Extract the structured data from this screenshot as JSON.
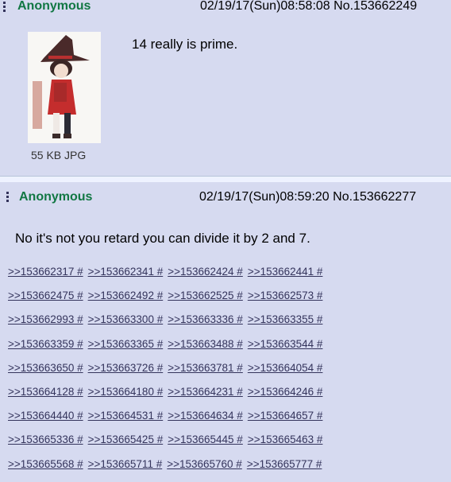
{
  "posts": [
    {
      "name": "Anonymous",
      "datetime": "02/19/17(Sun)08:58:08",
      "number": "No.153662249",
      "file_size": "55 KB JPG",
      "comment": "14 really is prime."
    },
    {
      "name": "Anonymous",
      "datetime": "02/19/17(Sun)08:59:20",
      "number": "No.153662277",
      "comment": "No it's not you retard you can divide it by 2 and 7.",
      "replies": [
        [
          ">>153662317 #",
          ">>153662341 #",
          ">>153662424 #",
          ">>153662441 #"
        ],
        [
          ">>153662475 #",
          ">>153662492 #",
          ">>153662525 #",
          ">>153662573 #"
        ],
        [
          ">>153662993 #",
          ">>153663300 #",
          ">>153663336 #",
          ">>153663355 #"
        ],
        [
          ">>153663359 #",
          ">>153663365 #",
          ">>153663488 #",
          ">>153663544 #"
        ],
        [
          ">>153663650 #",
          ">>153663726 #",
          ">>153663781 #",
          ">>153664054 #"
        ],
        [
          ">>153664128 #",
          ">>153664180 #",
          ">>153664231 #",
          ">>153664246 #"
        ],
        [
          ">>153664440 #",
          ">>153664531 #",
          ">>153664634 #",
          ">>153664657 #"
        ],
        [
          ">>153665336 #",
          ">>153665425 #",
          ">>153665445 #",
          ">>153665463 #"
        ],
        [
          ">>153665568 #",
          ">>153665711 #",
          ">>153665760 #",
          ">>153665777 #"
        ]
      ]
    }
  ]
}
